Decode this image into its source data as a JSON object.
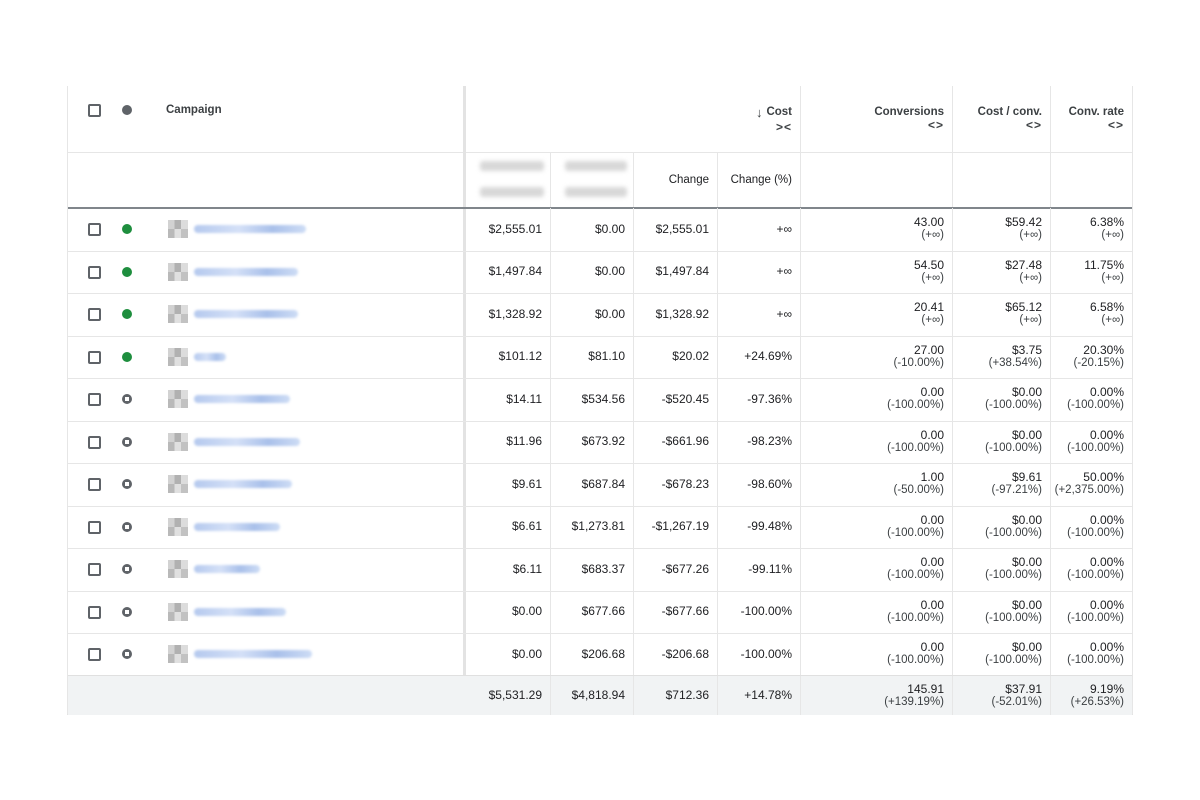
{
  "header": {
    "campaign_label": "Campaign",
    "cost_label": "Cost",
    "conversions_label": "Conversions",
    "cost_per_conv_label": "Cost / conv.",
    "conv_rate_label": "Conv. rate",
    "change_label": "Change",
    "change_pct_label": "Change (%)",
    "sort_arrow": "↓",
    "expand_arrows": "><",
    "collapse_arrows": "<>"
  },
  "rows": [
    {
      "status": "enabled",
      "cost_a": "$2,555.01",
      "cost_b": "$0.00",
      "change": "$2,555.01",
      "change_pct": "+∞",
      "conv": "43.00",
      "conv_sub": "(+∞)",
      "cpc": "$59.42",
      "cpc_sub": "(+∞)",
      "rate": "6.38%",
      "rate_sub": "(+∞)",
      "name_w": 112
    },
    {
      "status": "enabled",
      "cost_a": "$1,497.84",
      "cost_b": "$0.00",
      "change": "$1,497.84",
      "change_pct": "+∞",
      "conv": "54.50",
      "conv_sub": "(+∞)",
      "cpc": "$27.48",
      "cpc_sub": "(+∞)",
      "rate": "11.75%",
      "rate_sub": "(+∞)",
      "name_w": 104
    },
    {
      "status": "enabled",
      "cost_a": "$1,328.92",
      "cost_b": "$0.00",
      "change": "$1,328.92",
      "change_pct": "+∞",
      "conv": "20.41",
      "conv_sub": "(+∞)",
      "cpc": "$65.12",
      "cpc_sub": "(+∞)",
      "rate": "6.58%",
      "rate_sub": "(+∞)",
      "name_w": 104
    },
    {
      "status": "enabled",
      "cost_a": "$101.12",
      "cost_b": "$81.10",
      "change": "$20.02",
      "change_pct": "+24.69%",
      "conv": "27.00",
      "conv_sub": "(-10.00%)",
      "cpc": "$3.75",
      "cpc_sub": "(+38.54%)",
      "rate": "20.30%",
      "rate_sub": "(-20.15%)",
      "name_w": 32
    },
    {
      "status": "paused",
      "cost_a": "$14.11",
      "cost_b": "$534.56",
      "change": "-$520.45",
      "change_pct": "-97.36%",
      "conv": "0.00",
      "conv_sub": "(-100.00%)",
      "cpc": "$0.00",
      "cpc_sub": "(-100.00%)",
      "rate": "0.00%",
      "rate_sub": "(-100.00%)",
      "name_w": 96
    },
    {
      "status": "paused",
      "cost_a": "$11.96",
      "cost_b": "$673.92",
      "change": "-$661.96",
      "change_pct": "-98.23%",
      "conv": "0.00",
      "conv_sub": "(-100.00%)",
      "cpc": "$0.00",
      "cpc_sub": "(-100.00%)",
      "rate": "0.00%",
      "rate_sub": "(-100.00%)",
      "name_w": 106
    },
    {
      "status": "paused",
      "cost_a": "$9.61",
      "cost_b": "$687.84",
      "change": "-$678.23",
      "change_pct": "-98.60%",
      "conv": "1.00",
      "conv_sub": "(-50.00%)",
      "cpc": "$9.61",
      "cpc_sub": "(-97.21%)",
      "rate": "50.00%",
      "rate_sub": "(+2,375.00%)",
      "name_w": 98
    },
    {
      "status": "paused",
      "cost_a": "$6.61",
      "cost_b": "$1,273.81",
      "change": "-$1,267.19",
      "change_pct": "-99.48%",
      "conv": "0.00",
      "conv_sub": "(-100.00%)",
      "cpc": "$0.00",
      "cpc_sub": "(-100.00%)",
      "rate": "0.00%",
      "rate_sub": "(-100.00%)",
      "name_w": 86
    },
    {
      "status": "paused",
      "cost_a": "$6.11",
      "cost_b": "$683.37",
      "change": "-$677.26",
      "change_pct": "-99.11%",
      "conv": "0.00",
      "conv_sub": "(-100.00%)",
      "cpc": "$0.00",
      "cpc_sub": "(-100.00%)",
      "rate": "0.00%",
      "rate_sub": "(-100.00%)",
      "name_w": 66
    },
    {
      "status": "paused",
      "cost_a": "$0.00",
      "cost_b": "$677.66",
      "change": "-$677.66",
      "change_pct": "-100.00%",
      "conv": "0.00",
      "conv_sub": "(-100.00%)",
      "cpc": "$0.00",
      "cpc_sub": "(-100.00%)",
      "rate": "0.00%",
      "rate_sub": "(-100.00%)",
      "name_w": 92
    },
    {
      "status": "paused",
      "cost_a": "$0.00",
      "cost_b": "$206.68",
      "change": "-$206.68",
      "change_pct": "-100.00%",
      "conv": "0.00",
      "conv_sub": "(-100.00%)",
      "cpc": "$0.00",
      "cpc_sub": "(-100.00%)",
      "rate": "0.00%",
      "rate_sub": "(-100.00%)",
      "name_w": 118
    }
  ],
  "total": {
    "cost_a": "$5,531.29",
    "cost_b": "$4,818.94",
    "change": "$712.36",
    "change_pct": "+14.78%",
    "conv": "145.91",
    "conv_sub": "(+139.19%)",
    "cpc": "$37.91",
    "cpc_sub": "(-52.01%)",
    "rate": "9.19%",
    "rate_sub": "(+26.53%)"
  },
  "colors": {
    "enabled": "#1e8e3e",
    "paused": "#5f6368",
    "link_blur": "#b5c9ee",
    "total_bg": "#f1f3f4"
  }
}
